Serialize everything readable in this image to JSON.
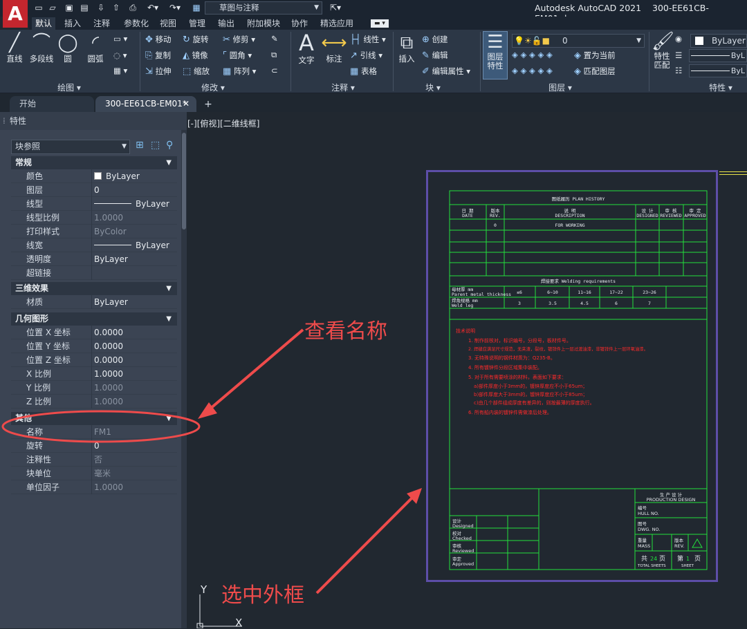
{
  "app": {
    "logo": "A",
    "title": "Autodesk AutoCAD 2021",
    "file": "300-EE61CB-EM01.dwg",
    "workspace": "草图与注释"
  },
  "qat": [
    "new-icon",
    "open-icon",
    "save-icon",
    "saveas-icon",
    "import-icon",
    "export-icon",
    "print-icon",
    "undo-icon",
    "redo-icon"
  ],
  "ribbon_tabs": [
    "默认",
    "插入",
    "注释",
    "参数化",
    "视图",
    "管理",
    "输出",
    "附加模块",
    "协作",
    "精选应用"
  ],
  "draw": {
    "line": "直线",
    "polyline": "多段线",
    "circle": "圆",
    "arc": "圆弧",
    "title": "绘图 ▾"
  },
  "modify": {
    "move": "移动",
    "rotate": "旋转",
    "trim": "修剪",
    "copy": "复制",
    "mirror": "镜像",
    "fillet": "圆角",
    "stretch": "拉伸",
    "scale": "缩放",
    "array": "阵列",
    "title": "修改 ▾"
  },
  "annotation": {
    "text": "文字",
    "dimension": "标注",
    "linear": "线性",
    "leader": "引线",
    "table": "表格",
    "title": "注释 ▾"
  },
  "block": {
    "insert": "插入",
    "create": "创建",
    "edit": "编辑",
    "edit_attr": "编辑属性",
    "title": "块 ▾"
  },
  "layers": {
    "layer_props": "图层\n特性",
    "current_layer": "0",
    "set_current": "置为当前",
    "match_layer": "匹配图层",
    "title": "图层 ▾"
  },
  "properties_panel": {
    "match": "特性\n匹配",
    "color": "ByLayer",
    "line1": "ByL",
    "line2": "ByL",
    "title": "特性 ▾"
  },
  "file_tabs": {
    "start": "开始",
    "file": "300-EE61CB-EM01*",
    "add": "+"
  },
  "palette": {
    "title": "特性",
    "object_type": "块参照",
    "sections": [
      {
        "name": "常规",
        "rows": [
          [
            "颜色",
            "ByLayer"
          ],
          [
            "图层",
            "0"
          ],
          [
            "线型",
            "ByLayer"
          ],
          [
            "线型比例",
            "1.0000"
          ],
          [
            "打印样式",
            "ByColor"
          ],
          [
            "线宽",
            "ByLayer"
          ],
          [
            "透明度",
            "ByLayer"
          ],
          [
            "超链接",
            ""
          ]
        ]
      },
      {
        "name": "三维效果",
        "rows": [
          [
            "材质",
            "ByLayer"
          ]
        ]
      },
      {
        "name": "几何图形",
        "rows": [
          [
            "位置 X 坐标",
            "0.0000"
          ],
          [
            "位置 Y 坐标",
            "0.0000"
          ],
          [
            "位置 Z 坐标",
            "0.0000"
          ],
          [
            "X 比例",
            "1.0000"
          ],
          [
            "Y 比例",
            "1.0000"
          ],
          [
            "Z 比例",
            "1.0000"
          ]
        ]
      },
      {
        "name": "其他",
        "rows": [
          [
            "名称",
            "FM1"
          ],
          [
            "旋转",
            "0"
          ],
          [
            "注释性",
            "否"
          ],
          [
            "块单位",
            "毫米"
          ],
          [
            "单位因子",
            "1.0000"
          ]
        ]
      }
    ]
  },
  "viewport": {
    "label": "[-][俯视][二维线框]"
  },
  "ucs": {
    "y": "Y",
    "x": "X"
  },
  "sheet": {
    "history_title": "图纸履历 PLAN HISTORY",
    "history_headers": [
      [
        "日 期",
        "DATE"
      ],
      [
        "版本",
        "REV."
      ],
      [
        "说 明",
        "DESCRIPTION"
      ],
      [
        "设 计",
        "DESIGNED"
      ],
      [
        "审 核",
        "REVIEWED"
      ],
      [
        "审 定",
        "APPROVED"
      ]
    ],
    "history_row": {
      "rev": "0",
      "desc": "FOR WORKING"
    },
    "weld_title": "焊接要求 Welding requirements",
    "weld_rows": [
      {
        "label": "母材厚 mm",
        "sub": "Parent metal thickness",
        "vals": [
          "≤6",
          "6~10",
          "11~16",
          "17~22",
          "23~26"
        ]
      },
      {
        "label": "焊角规格 mm",
        "sub": "Weld leg",
        "vals": [
          "3",
          "3.5",
          "4.5",
          "6",
          "7"
        ]
      }
    ],
    "notes": [
      "技术说明",
      "1. 制作前核对，标识编号，分段号，板材件号。",
      "2. 焊缝应满足尺寸规范，无夹渣，裂纹，镀锌件上一层过渡油漆，非镀锌件上一层环氧油漆。",
      "3. 无特殊说明的钢件材质为：Q235-B。",
      "4. 所有镀锌件分段区域集中装配。",
      "5. 对于所有需要喷涂的材料，表面如下要求：",
      "a)部件厚度小于3mm的，镀锌厚度应不小于65um；",
      "b)部件厚度大于3mm的，镀锌厚度应不小于85um；",
      "c)由几个部件组成厚度有差异的，则按最薄的厚度执行。",
      "6. 所有船内装的镀锌件需做漆后处理。"
    ],
    "title_block": {
      "production": "生 产 设 计",
      "production_en": "PRODUCTION DESIGN",
      "hull": "编号",
      "hull_en": "HULL NO.",
      "dwg": "图号",
      "dwg_en": "DWG. NO.",
      "mass": "重量",
      "mass_en": "MASS",
      "rev": "版本",
      "rev_en": "REV.",
      "total": "共",
      "total_n": "24",
      "pages": "页",
      "total_en": "TOTAL SHEETS",
      "sheet": "第",
      "sheet_n": "1",
      "sheet_en": "SHEET",
      "designed": "设计",
      "designed_en": "Designed",
      "checked": "校对",
      "checked_en": "Checked",
      "reviewed": "审核",
      "reviewed_en": "Reviewed",
      "approved": "审定",
      "approved_en": "Approved"
    }
  },
  "annotations": {
    "view_name": "查看名称",
    "select_frame": "选中外框"
  },
  "colors": {
    "drawing_bg": "#212830",
    "green": "#22e03c",
    "red": "#ff2a2a",
    "frame": "#5d4ea8",
    "arrow": "#ee4b4b"
  }
}
